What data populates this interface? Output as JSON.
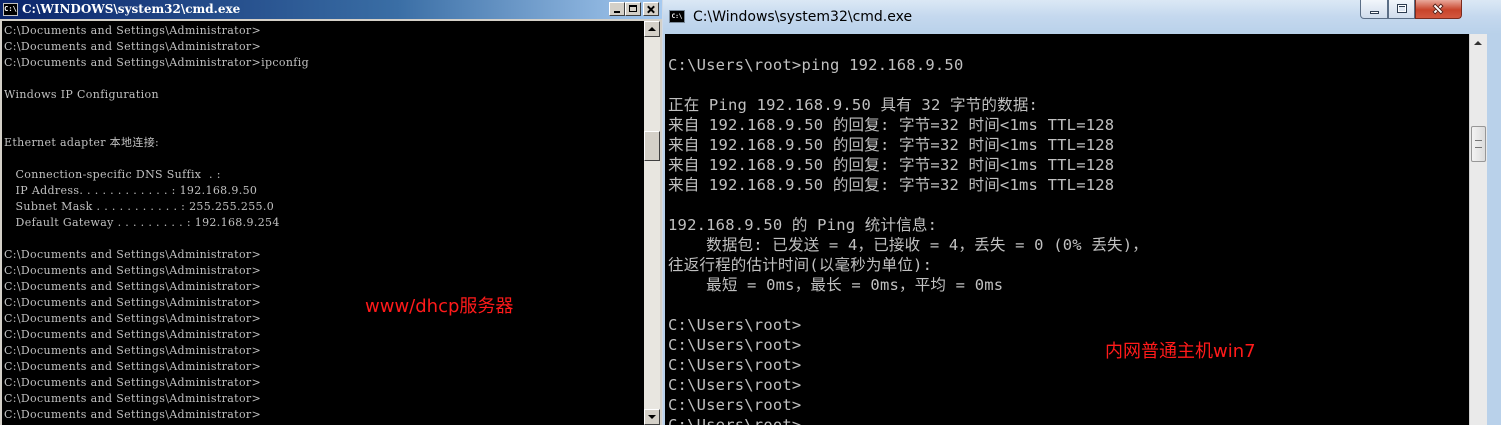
{
  "left_window": {
    "title": "C:\\WINDOWS\\system32\\cmd.exe",
    "icon": "cmd-icon",
    "icon_text": "C:\\",
    "lines": [
      "C:\\Documents and Settings\\Administrator>",
      "C:\\Documents and Settings\\Administrator>",
      "C:\\Documents and Settings\\Administrator>ipconfig",
      "",
      "Windows IP Configuration",
      "",
      "",
      "Ethernet adapter 本地连接:",
      "",
      "   Connection-specific DNS Suffix  . :",
      "   IP Address. . . . . . . . . . . . : 192.168.9.50",
      "   Subnet Mask . . . . . . . . . . . : 255.255.255.0",
      "   Default Gateway . . . . . . . . . : 192.168.9.254",
      "",
      "C:\\Documents and Settings\\Administrator>",
      "C:\\Documents and Settings\\Administrator>",
      "C:\\Documents and Settings\\Administrator>",
      "C:\\Documents and Settings\\Administrator>",
      "C:\\Documents and Settings\\Administrator>",
      "C:\\Documents and Settings\\Administrator>",
      "C:\\Documents and Settings\\Administrator>",
      "C:\\Documents and Settings\\Administrator>",
      "C:\\Documents and Settings\\Administrator>",
      "C:\\Documents and Settings\\Administrator>",
      "C:\\Documents and Settings\\Administrator>",
      "C:\\Documents and Settings\\Administrator>"
    ],
    "annotation": "www/dhcp服务器",
    "annotation_color": "#ff1a1a"
  },
  "right_window": {
    "title": "C:\\Windows\\system32\\cmd.exe",
    "icon": "cmd-icon",
    "icon_text": "C:\\",
    "lines": [
      "C:\\Users\\root>ping 192.168.9.50",
      "",
      "正在 Ping 192.168.9.50 具有 32 字节的数据:",
      "来自 192.168.9.50 的回复: 字节=32 时间<1ms TTL=128",
      "来自 192.168.9.50 的回复: 字节=32 时间<1ms TTL=128",
      "来自 192.168.9.50 的回复: 字节=32 时间<1ms TTL=128",
      "来自 192.168.9.50 的回复: 字节=32 时间<1ms TTL=128",
      "",
      "192.168.9.50 的 Ping 统计信息:",
      "    数据包: 已发送 = 4，已接收 = 4，丢失 = 0 (0% 丢失)，",
      "往返行程的估计时间(以毫秒为单位):",
      "    最短 = 0ms，最长 = 0ms，平均 = 0ms",
      "",
      "C:\\Users\\root>",
      "C:\\Users\\root>",
      "C:\\Users\\root>",
      "C:\\Users\\root>",
      "C:\\Users\\root>",
      "C:\\Users\\root>"
    ],
    "annotation": "内网普通主机win7",
    "annotation_color": "#ff1a1a"
  },
  "colors": {
    "console_bg": "#000000",
    "console_text": "#c0c0c0",
    "xp_title_start": "#0a246a",
    "xp_title_end": "#a6caf0",
    "aero_frame": "#b9d1ea",
    "close_button": "#c8442b"
  }
}
